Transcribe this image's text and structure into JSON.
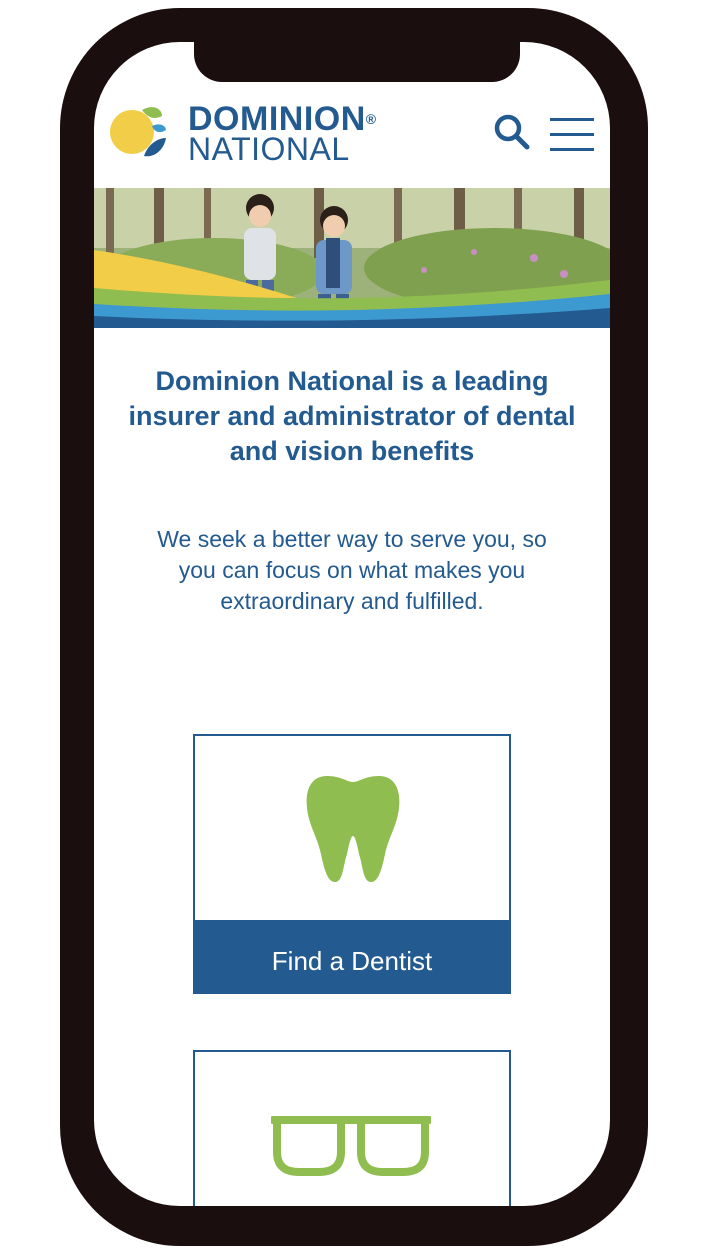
{
  "brand": {
    "name_line1": "DOMINION",
    "name_line2": "NATIONAL",
    "registered_mark": "®",
    "primary_color": "#235a8f",
    "accent_green": "#8fbd4f",
    "accent_yellow": "#f2cd47"
  },
  "header": {
    "search_icon": "search-icon",
    "menu_icon": "hamburger-menu-icon"
  },
  "main": {
    "headline": "Dominion National is a leading insurer and administrator of dental and vision benefits",
    "intro": "We seek a better way to serve you, so you can focus on what makes you extraordinary and fulfilled."
  },
  "cards": [
    {
      "icon": "tooth-icon",
      "label": "Find a Dentist"
    },
    {
      "icon": "eyeglasses-icon",
      "label": ""
    }
  ]
}
